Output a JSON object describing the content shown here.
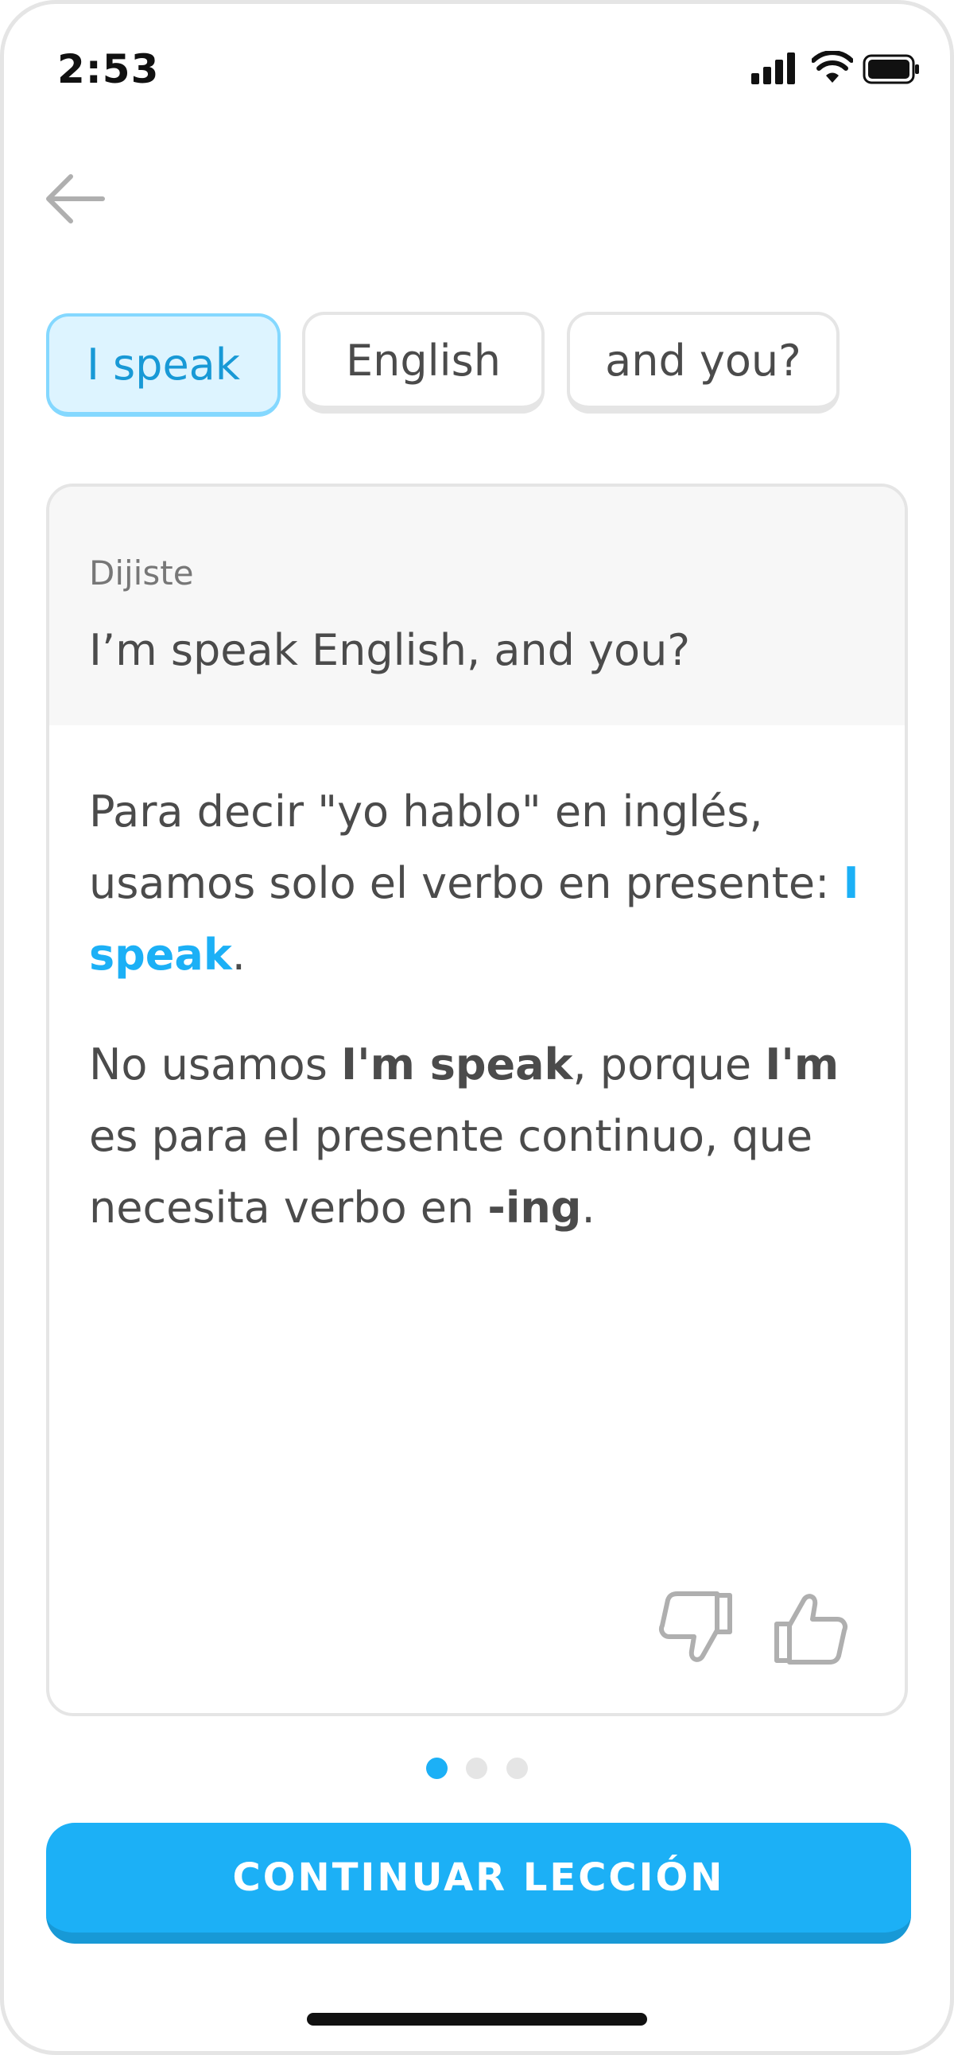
{
  "status_bar": {
    "time": "2:53"
  },
  "chips": [
    {
      "label": "I speak",
      "selected": true
    },
    {
      "label": "English",
      "selected": false
    },
    {
      "label": "and you?",
      "selected": false
    }
  ],
  "feedback_card": {
    "said_label": "Dijiste",
    "said_text": "I’m speak English, and you?",
    "para1": {
      "text": "Para decir \"yo hablo\" en inglés, usamos solo el verbo en presente: ",
      "highlight": "I speak",
      "end": "."
    },
    "para2": {
      "part1": "No usamos ",
      "bold1": "I'm speak",
      "part2": ", porque ",
      "bold2": "I'm",
      "part3": " es para el presente continuo, que necesita verbo en ",
      "bold3": "-ing",
      "end": "."
    }
  },
  "pager": {
    "count": 3,
    "active_index": 0
  },
  "continue_button": {
    "label": "CONTINUAR LECCIÓN"
  },
  "colors": {
    "accent": "#1cb0f6",
    "accent_dark": "#1899d6",
    "chip_selected_bg": "#ddf4ff",
    "border": "#e5e5e5"
  },
  "icons": [
    "back-arrow-icon",
    "signal-icon",
    "wifi-icon",
    "battery-icon",
    "thumbs-down-icon",
    "thumbs-up-icon"
  ]
}
